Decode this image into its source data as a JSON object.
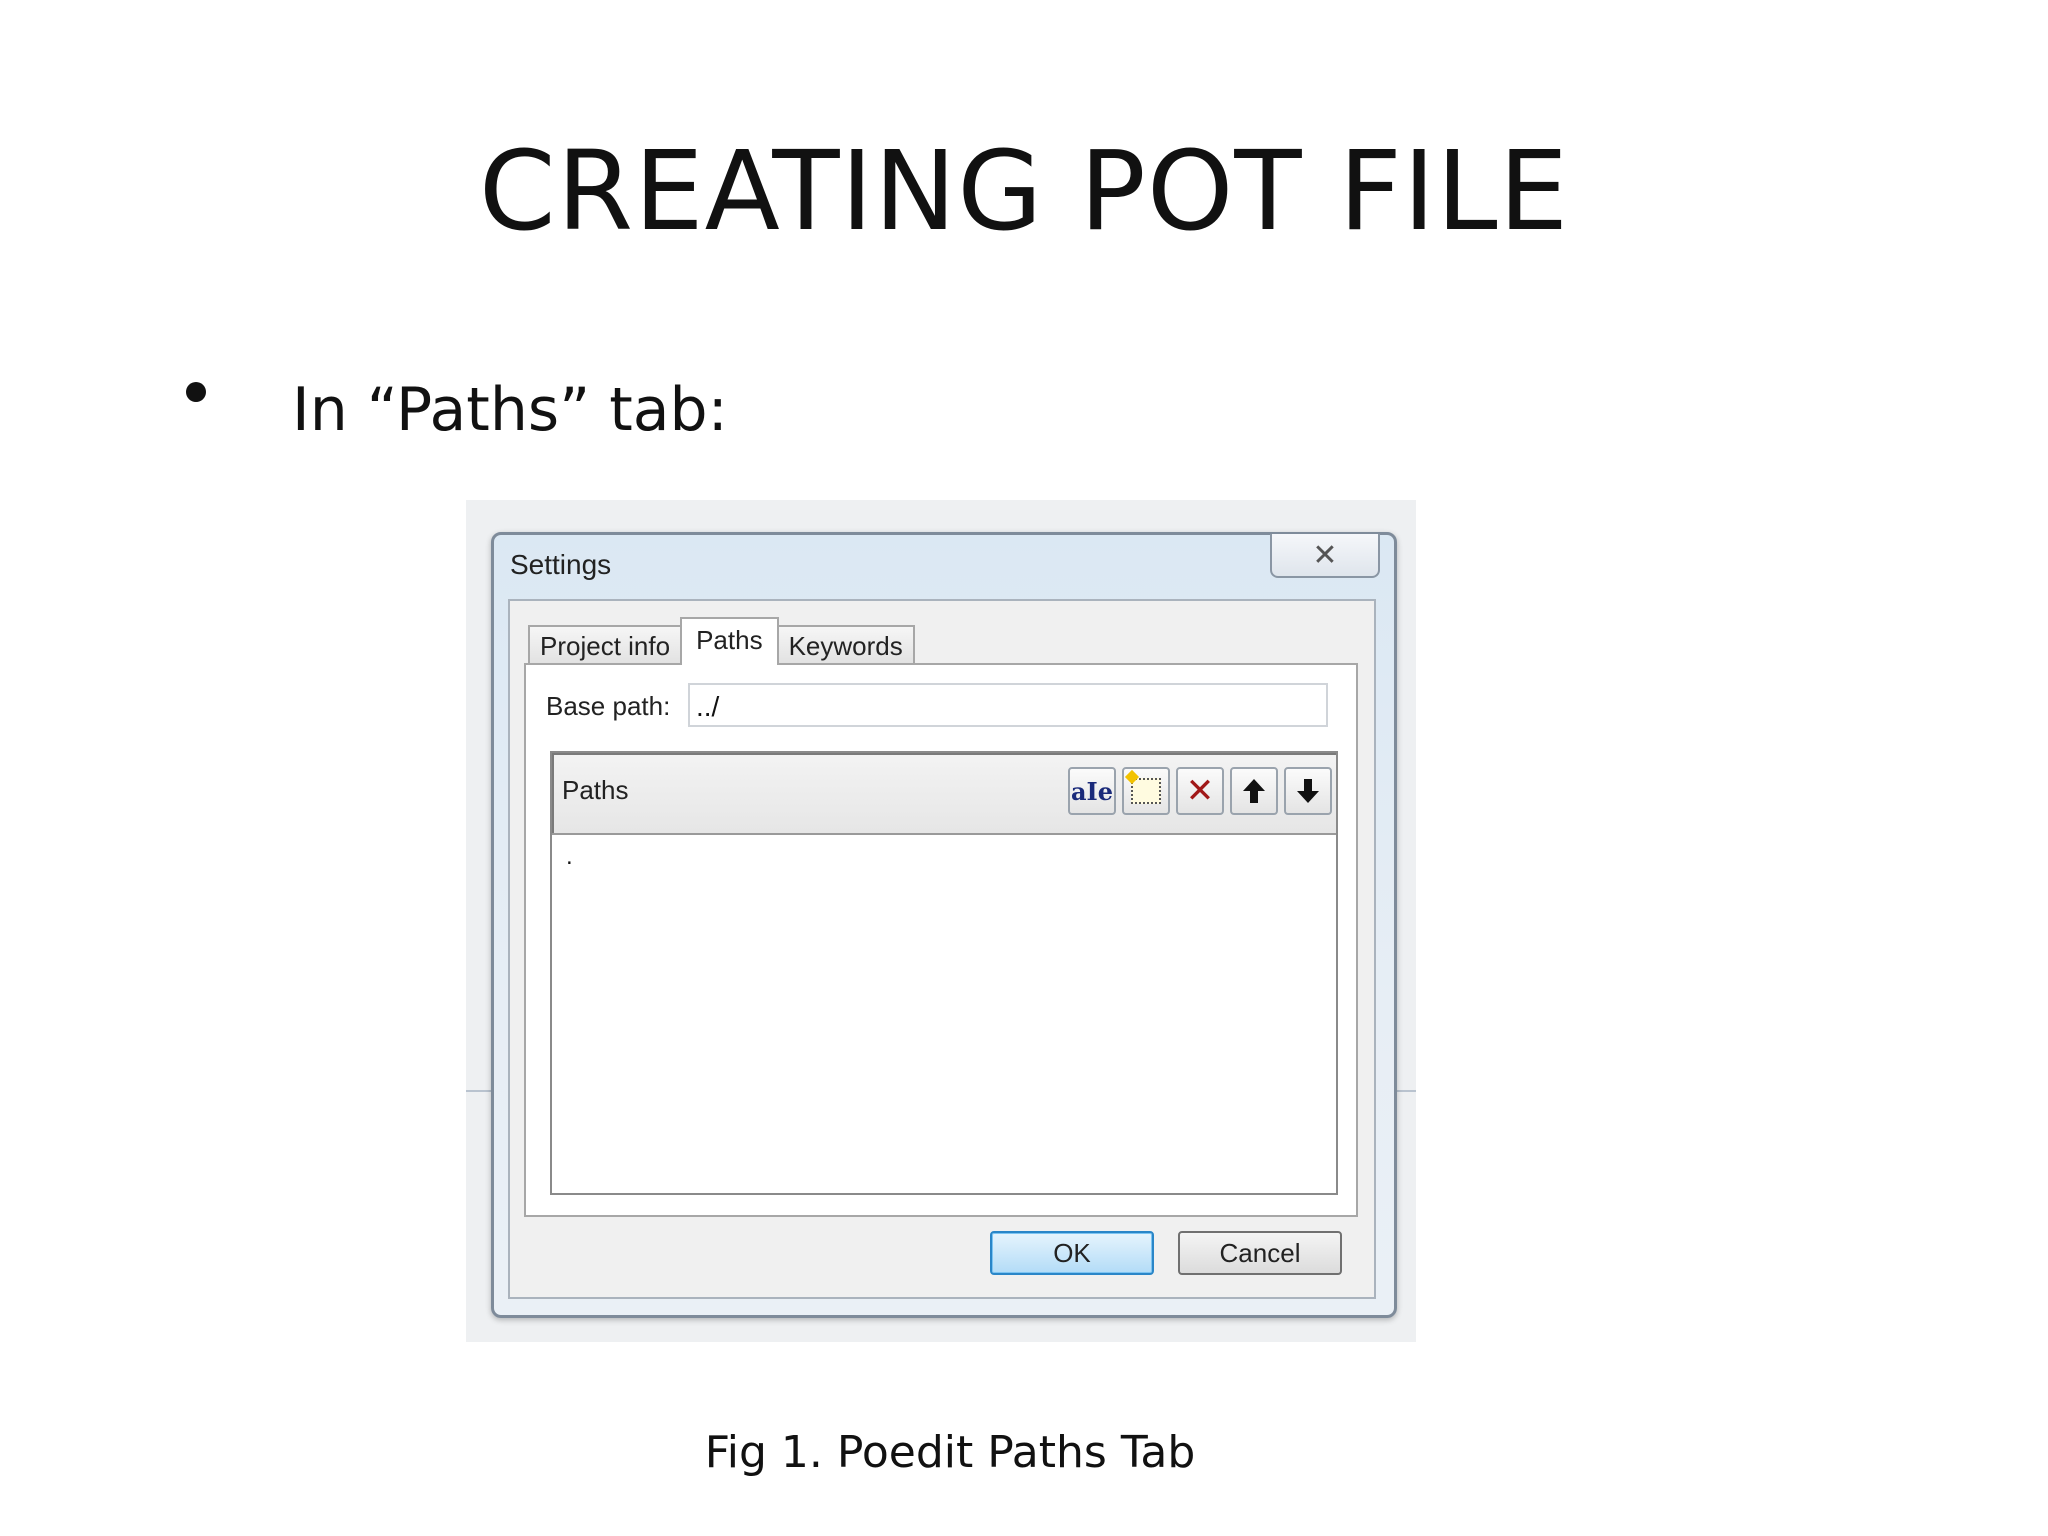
{
  "slide": {
    "title": "CREATING POT FILE",
    "bullet": "In “Paths” tab:",
    "caption": "Fig 1. Poedit Paths Tab"
  },
  "dialog": {
    "title": "Settings",
    "close_glyph": "✕",
    "tabs": [
      {
        "label": "Project info",
        "active": false
      },
      {
        "label": "Paths",
        "active": true
      },
      {
        "label": "Keywords",
        "active": false
      }
    ],
    "base_path_label": "Base path:",
    "base_path_value": "../",
    "paths_header": "Paths",
    "toolbar": [
      {
        "name": "edit-item-icon",
        "glyph": "aIe"
      },
      {
        "name": "new-item-icon",
        "glyph": ""
      },
      {
        "name": "delete-item-icon",
        "glyph": "✕"
      },
      {
        "name": "move-up-icon",
        "glyph": "🡅"
      },
      {
        "name": "move-down-icon",
        "glyph": "🡇"
      }
    ],
    "paths_items": [
      "."
    ],
    "ok_label": "OK",
    "cancel_label": "Cancel"
  }
}
